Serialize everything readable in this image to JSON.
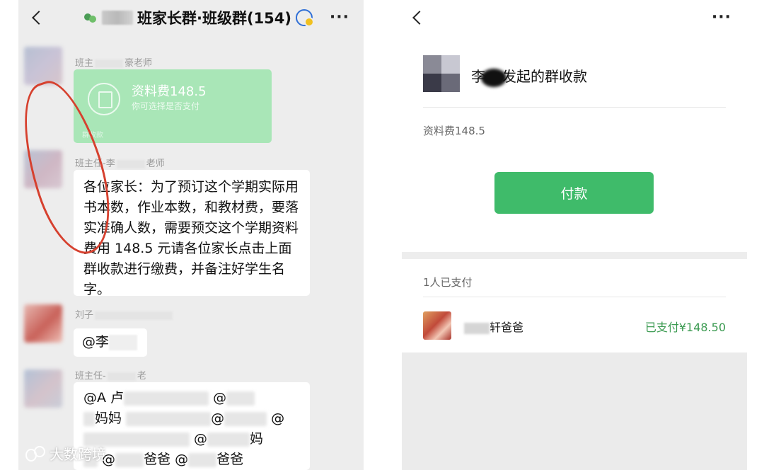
{
  "chat": {
    "title": "班家长群·班级群(154)",
    "messages": [
      {
        "sender_prefix": "班主",
        "sender_suffix": "豪老师",
        "card": {
          "title": "资料费148.5",
          "subtitle": "你可选择是否支付",
          "footer": "群收款"
        }
      },
      {
        "sender_prefix": "班主任-李",
        "sender_suffix": "老师",
        "text": "各位家长：为了预订这个学期实际用书本数，作业本数，和教材费，要落实准确人数，需要预交这个学期资料费用 148.5 元请各位家长点击上面群收款进行缴费，并备注好学生名字。"
      },
      {
        "sender_prefix": "刘子",
        "text": "@李"
      },
      {
        "sender_prefix": "班主任-",
        "sender_suffix": "老",
        "mentions": [
          "@A 卢",
          "@",
          "妈妈",
          "@",
          "@",
          "妈",
          "@",
          "爸爸",
          "@",
          "爸爸",
          "@",
          "@"
        ]
      }
    ],
    "watermark": "大数跨境"
  },
  "collection": {
    "initiator_prefix": "李",
    "initiator_suffix": "发起的群收款",
    "item_desc": "资料费148.5",
    "pay_button": "付款",
    "paid_count": "1人已支付",
    "payer": {
      "name": "轩爸爸",
      "status": "已支付¥148.50"
    }
  },
  "colors": {
    "wechat_green": "#3fbb6a",
    "card_green": "#a9e6b7",
    "annotation_red": "#d6402e",
    "chat_bg": "#ededed"
  }
}
